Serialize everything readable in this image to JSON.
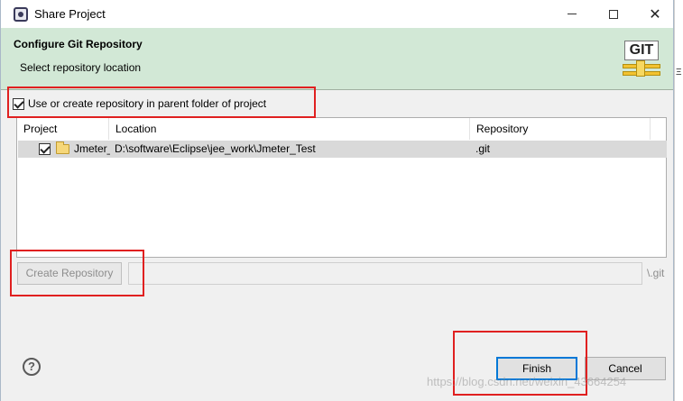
{
  "window": {
    "title": "Share Project"
  },
  "banner": {
    "title": "Configure Git Repository",
    "subtitle": "Select repository location",
    "logo_text": "GIT"
  },
  "options": {
    "use_parent_label": "Use or create repository in parent folder of project",
    "use_parent_checked": true
  },
  "table": {
    "columns": [
      "Project",
      "Location",
      "Repository"
    ],
    "rows": [
      {
        "checked": true,
        "project": "Jmeter_Test",
        "location": "D:\\software\\Eclipse\\jee_work\\Jmeter_Test",
        "repository": ".git"
      }
    ]
  },
  "create": {
    "button_label": "Create Repository",
    "path_value": "",
    "suffix": "\\.git"
  },
  "buttons": {
    "help": "?",
    "finish": "Finish",
    "cancel": "Cancel"
  },
  "watermark": "https://blog.csdn.net/weixin_43664254",
  "colors": {
    "banner": "#d2e8d6",
    "highlight": "#e02020",
    "default_button_border": "#0078d7"
  }
}
